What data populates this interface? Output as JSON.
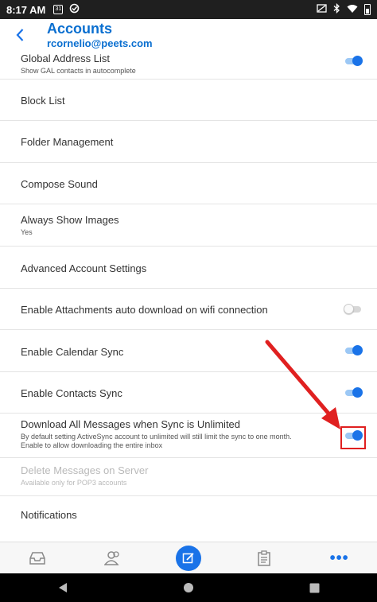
{
  "status_bar": {
    "time": "8:17 AM",
    "calendar_day": "31"
  },
  "header": {
    "title": "Accounts",
    "subtitle": "rcornelio@peets.com"
  },
  "settings": [
    {
      "label": "Global Address List",
      "sub": "Show GAL contacts in autocomplete",
      "toggle": "on"
    },
    {
      "label": "Block List"
    },
    {
      "label": "Folder Management"
    },
    {
      "label": "Compose Sound"
    },
    {
      "label": "Always Show Images",
      "sub": "Yes"
    },
    {
      "label": "Advanced Account Settings"
    },
    {
      "label": "Enable Attachments auto download on wifi connection",
      "toggle": "off"
    },
    {
      "label": "Enable Calendar Sync",
      "toggle": "on"
    },
    {
      "label": "Enable Contacts Sync",
      "toggle": "on"
    },
    {
      "label": "Download All Messages when Sync is Unlimited",
      "sub": "By default setting ActiveSync account to unlimited will still limit the sync to one month. Enable to allow downloading the entire inbox",
      "toggle": "on"
    },
    {
      "label": "Delete Messages on Server",
      "sub": "Available only for POP3 accounts",
      "disabled": true
    },
    {
      "label": "Notifications"
    }
  ],
  "tab_bar": {
    "more_label": "•••",
    "icons": [
      "inbox-icon",
      "contacts-icon",
      "compose-icon",
      "tasks-icon",
      "more-icon"
    ]
  },
  "colors": {
    "accent": "#1a73e8",
    "title": "#0a6fd0",
    "highlight": "#e02020"
  }
}
